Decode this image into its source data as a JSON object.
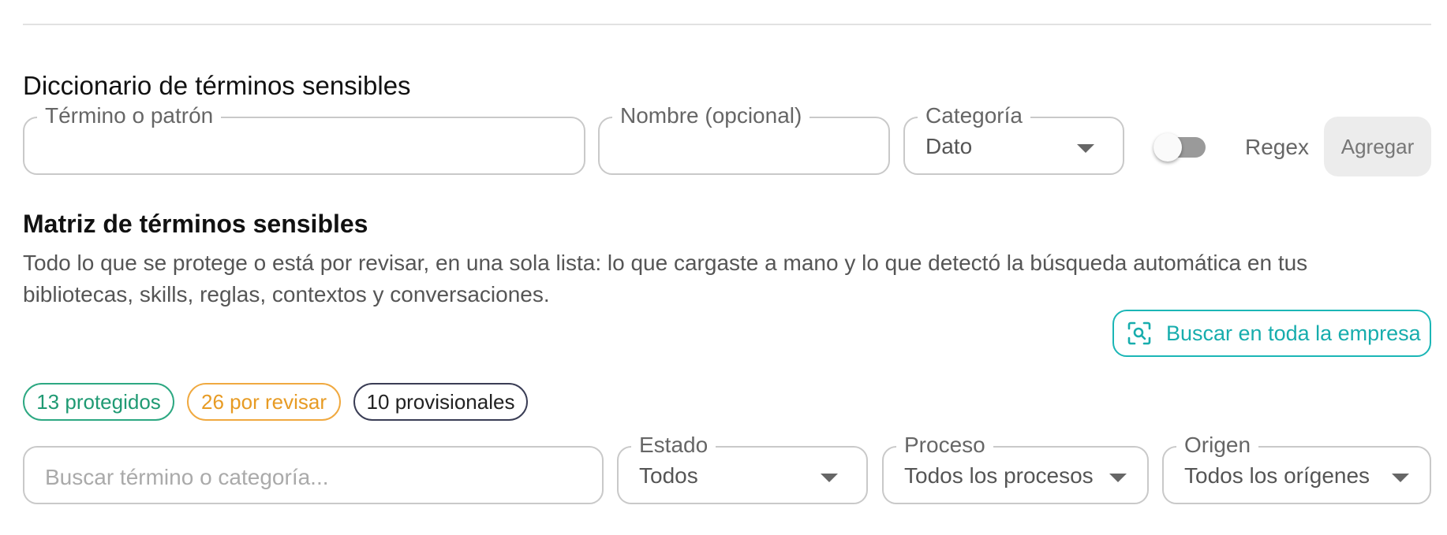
{
  "dictionary": {
    "title": "Diccionario de términos sensibles",
    "term_field": {
      "label": "Término o patrón",
      "value": ""
    },
    "name_field": {
      "label": "Nombre (opcional)",
      "value": ""
    },
    "category_field": {
      "label": "Categoría",
      "value": "Dato"
    },
    "regex_toggle": {
      "label": "Regex",
      "on": false
    },
    "add_button": "Agregar"
  },
  "matrix": {
    "title": "Matriz de términos sensibles",
    "description": "Todo lo que se protege o está por revisar, en una sola lista: lo que cargaste a mano y lo que detectó la búsqueda automática en tus bibliotecas, skills, reglas, contextos y conversaciones.",
    "search_company_button": "Buscar en toda la empresa",
    "chips": {
      "protected": "13 protegidos",
      "review": "26 por revisar",
      "provisional": "10 provisionales"
    },
    "filters": {
      "search_placeholder": "Buscar término o categoría...",
      "status": {
        "label": "Estado",
        "value": "Todos"
      },
      "process": {
        "label": "Proceso",
        "value": "Todos los procesos"
      },
      "origin": {
        "label": "Origen",
        "value": "Todos los orígenes"
      }
    }
  },
  "colors": {
    "accent_teal": "#17adad",
    "protected_green": "#1f9a73",
    "review_orange": "#e79b24",
    "provisional_navy": "#3a3d55"
  },
  "icons": {
    "search_company": "scan-search-icon",
    "dropdown": "caret-down-icon"
  }
}
